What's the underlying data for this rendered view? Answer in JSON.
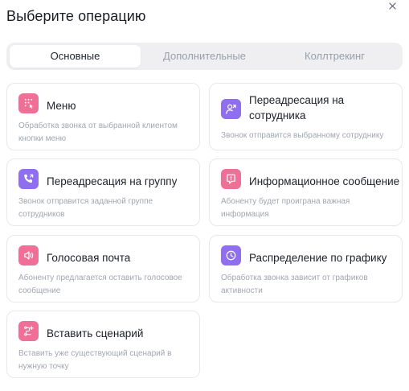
{
  "dialog": {
    "title": "Выберите операцию",
    "close_icon": "close-icon"
  },
  "tabs": [
    {
      "label": "Основные",
      "active": true
    },
    {
      "label": "Дополнительные",
      "active": false
    },
    {
      "label": "Коллтрекинг",
      "active": false
    }
  ],
  "operations": [
    {
      "title": "Меню",
      "description": "Обработка звонка от выбранной клиентом кнопки меню",
      "icon": "dialpad-icon",
      "color": "#ef6f96"
    },
    {
      "title": "Переадресация на сотрудника",
      "description": "Звонок отправится выбранному сотруднику",
      "icon": "user-forward-icon",
      "color": "#8f6ef0"
    },
    {
      "title": "Переадресация на группу",
      "description": "Звонок отправится заданной группе сотрудников",
      "icon": "phone-forward-icon",
      "color": "#8f6ef0"
    },
    {
      "title": "Информационное сообщение",
      "description": "Абоненту будет проиграна важная информация",
      "icon": "message-icon",
      "color": "#ef6f96"
    },
    {
      "title": "Голосовая почта",
      "description": "Абоненту предлагается оставить голосовое сообщение",
      "icon": "voicemail-icon",
      "color": "#ef6f96"
    },
    {
      "title": "Распределение по графику",
      "description": "Обработка звонка зависит от графиков активности",
      "icon": "clock-icon",
      "color": "#8f6ef0"
    },
    {
      "title": "Вставить сценарий",
      "description": "Вставить уже существующий сценарий в нужную точку",
      "icon": "scenario-icon",
      "color": "#ef6f96"
    }
  ]
}
